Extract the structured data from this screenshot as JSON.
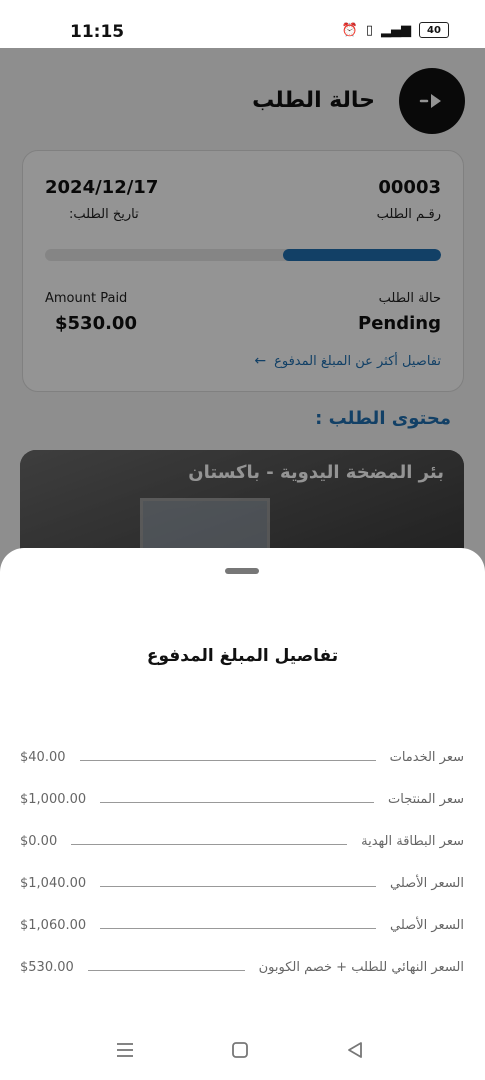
{
  "status_bar": {
    "time": "11:15",
    "battery": "40"
  },
  "header": {
    "title": "حالة الطلب"
  },
  "order_card": {
    "order_number": "00003",
    "order_number_label": "رقـم الطلب",
    "order_date": "2024/12/17",
    "order_date_label": "تاريخ الطلب:",
    "progress_fraction": 0.4,
    "status_label": "حالة الطلب",
    "status_value": "Pending",
    "amount_paid_label": "Amount Paid",
    "amount_paid_value": "$530.00",
    "details_link": "تفاصيل أكثر عن المبلغ المدفوع"
  },
  "content": {
    "heading": "محتوى الطلب :",
    "product_title": "بئر المضخة اليدوية - باكستان"
  },
  "sheet": {
    "title": "تفاصيل المبلغ المدفوع",
    "rows": [
      {
        "label": "سعر الخدمات",
        "value": "$40.00"
      },
      {
        "label": "سعر المنتجات",
        "value": "$1,000.00"
      },
      {
        "label": "سعر البطاقة الهدية",
        "value": "$0.00"
      },
      {
        "label": "السعر الأصلي",
        "value": "$1,040.00"
      },
      {
        "label": "السعر الأصلي",
        "value": "$1,060.00"
      },
      {
        "label": "السعر النهائي للطلب + خصم الكوبون",
        "value": "$530.00"
      }
    ]
  },
  "colors": {
    "accent": "#1f6fb0",
    "dark": "#111111",
    "overlay": "rgba(0,0,0,0.42)"
  }
}
